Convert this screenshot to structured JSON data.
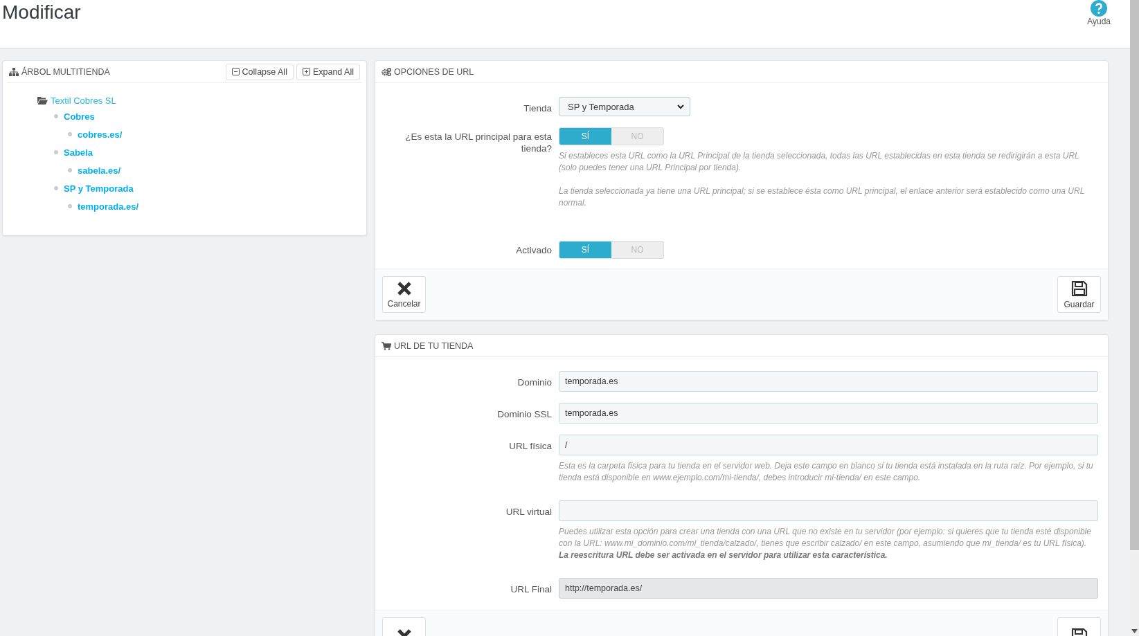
{
  "page_title": "Modificar",
  "help": {
    "label": "Ayuda"
  },
  "tree_panel": {
    "title": "ÁRBOL MULTITIENDA",
    "buttons": [
      {
        "label": "Collapse All",
        "kind": "collapse"
      },
      {
        "label": "Expand All",
        "kind": "expand"
      }
    ],
    "tree": {
      "label": "Textil Cobres SL",
      "expanded": true,
      "children": [
        {
          "label": "Cobres",
          "children": [
            {
              "label": "cobres.es/"
            }
          ]
        },
        {
          "label": "Sabela",
          "children": [
            {
              "label": "sabela.es/"
            }
          ]
        },
        {
          "label": "SP y Temporada",
          "children": [
            {
              "label": "temporada.es/"
            }
          ]
        }
      ]
    }
  },
  "url_options": {
    "title": "OPCIONES DE URL",
    "fields": [
      {
        "kind": "select",
        "label": "Tienda",
        "value": "SP y Temporada"
      },
      {
        "kind": "switch",
        "label": "¿Es esta la URL principal para esta tienda?",
        "options": [
          {
            "label": "SÍ",
            "selected": true
          },
          {
            "label": "NO",
            "selected": false
          }
        ],
        "help": [
          "Si estableces esta URL como la URL Principal de la tienda seleccionada, todas las URL establecidas en esta tienda se redirigirán a esta URL (solo puedes tener una URL Principal por tienda).",
          "La tienda seleccionada ya tiene una URL principal; si se establece ésta como URL principal, el enlace anterior será establecido como una URL normal."
        ]
      },
      {
        "kind": "switch",
        "label": "Activado",
        "options": [
          {
            "label": "SÍ",
            "selected": true
          },
          {
            "label": "NO",
            "selected": false
          }
        ]
      }
    ],
    "buttons": [
      {
        "label": "Cancelar",
        "kind": "cancel"
      },
      {
        "label": "Guardar",
        "kind": "save"
      }
    ]
  },
  "shop_url": {
    "title": "URL DE TU TIENDA",
    "fields": [
      {
        "kind": "input",
        "label": "Dominio",
        "value": "temporada.es",
        "disabled": false
      },
      {
        "kind": "input",
        "label": "Dominio SSL",
        "value": "temporada.es",
        "disabled": false
      },
      {
        "kind": "input",
        "label": "URL física",
        "value": "/",
        "disabled": false,
        "help": [
          "Esta es la carpeta física para tu tienda en el servidor web. Deja este campo en blanco si tu tienda está instalada en la ruta raíz. Por ejemplo, si tu tienda está disponible en www.ejemplo.com/mi-tienda/, debes introducir mi-tienda/ en este campo."
        ]
      },
      {
        "kind": "input",
        "label": "URL virtual",
        "disabled": false,
        "help": [
          "Puedes utilizar esta opción para crear una tienda con una URL que no existe en tu servidor (por ejemplo: si quieres que tu tienda esté disponible con la URL: www.mi_dominio.com/mi_tienda/calzado/, tienes que escribir calzado/ en este campo, asumiendo que mi_tienda/ es tu URL física).\n**La reescritura URL debe ser activada en el servidor para utilizar esta característica.**"
        ]
      },
      {
        "kind": "input",
        "label": "URL Final",
        "value": "http://temporada.es/",
        "disabled": true
      }
    ],
    "buttons": [
      {
        "kind": "cancel"
      },
      {
        "kind": "save"
      }
    ]
  }
}
